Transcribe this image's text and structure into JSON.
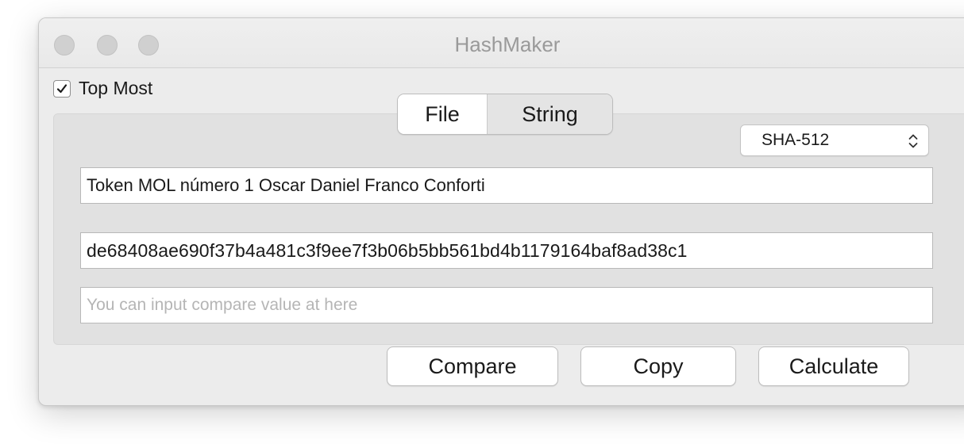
{
  "window": {
    "title": "HashMaker"
  },
  "top_most": {
    "label": "Top Most",
    "checked": true
  },
  "tabs": [
    {
      "label": "File",
      "selected": true
    },
    {
      "label": "String",
      "selected": false
    }
  ],
  "algorithm": {
    "selected": "SHA-512"
  },
  "fields": {
    "input_value": "Token MOL número 1 Oscar Daniel Franco Conforti",
    "hash_value": "de68408ae690f37b4a481c3f9ee7f3b06b5bb561bd4b1179164baf8ad38c1",
    "compare_placeholder": "You can input compare value at here"
  },
  "buttons": {
    "compare": "Compare",
    "copy": "Copy",
    "calculate": "Calculate"
  }
}
